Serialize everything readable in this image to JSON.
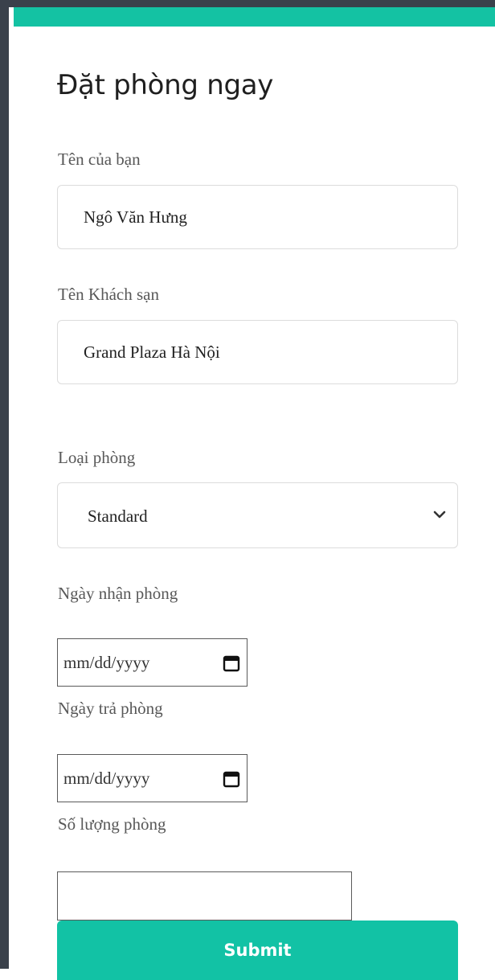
{
  "colors": {
    "accent": "#14c2a3",
    "frame": "#3a414b",
    "label_text": "#585858",
    "button_text": "#ffffff"
  },
  "form": {
    "title": "Đặt phòng ngay",
    "name": {
      "label": "Tên của bạn",
      "value": "Ngô Văn Hưng"
    },
    "hotel": {
      "label": "Tên Khách sạn",
      "value": "Grand Plaza Hà Nội"
    },
    "room_type": {
      "label": "Loại phòng",
      "selected": "Standard",
      "icon": "chevron-down-icon"
    },
    "check_in": {
      "label": "Ngày nhận phòng",
      "placeholder": "mm/dd/yyyy",
      "icon": "calendar-icon"
    },
    "check_out": {
      "label": "Ngày trả phòng",
      "placeholder": "mm/dd/yyyy",
      "icon": "calendar-icon"
    },
    "room_count": {
      "label": "Số lượng phòng",
      "value": ""
    },
    "submit_label": "Submit"
  }
}
